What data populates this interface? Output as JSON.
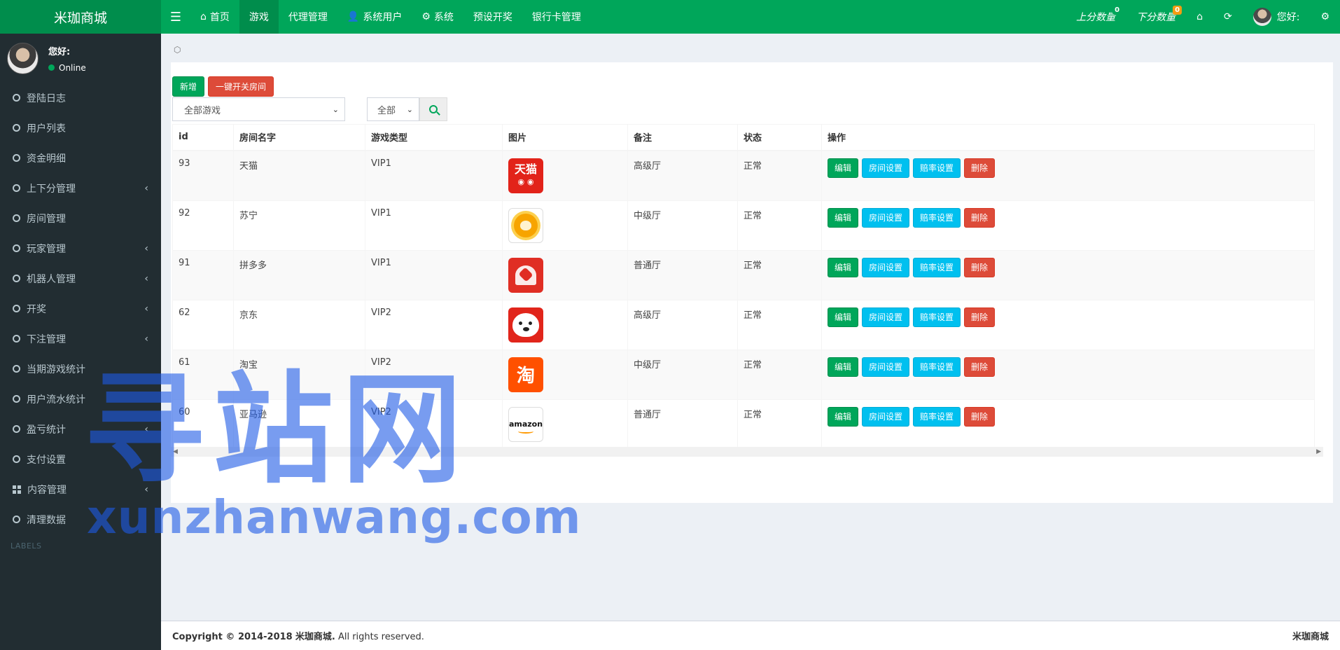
{
  "app": {
    "title": "米珈商城"
  },
  "topnav": [
    {
      "label": "首页",
      "icon": "home-icon"
    },
    {
      "label": "游戏",
      "icon": ""
    },
    {
      "label": "代理管理",
      "icon": ""
    },
    {
      "label": "系统用户",
      "icon": "user-icon"
    },
    {
      "label": "系统",
      "icon": "gear-icon"
    },
    {
      "label": "预设开奖",
      "icon": ""
    },
    {
      "label": "银行卡管理",
      "icon": ""
    }
  ],
  "topright": {
    "up_label": "上分数量",
    "up_count": "0",
    "up_badge_color": "#00a65a",
    "down_label": "下分数量",
    "down_count": "0",
    "down_badge_color": "#f39c12",
    "greeting": "您好:"
  },
  "user": {
    "name": "您好:",
    "status": "Online"
  },
  "sidebar": {
    "items": [
      {
        "label": "登陆日志",
        "has_children": false
      },
      {
        "label": "用户列表",
        "has_children": false
      },
      {
        "label": "资金明细",
        "has_children": false
      },
      {
        "label": "上下分管理",
        "has_children": true
      },
      {
        "label": "房间管理",
        "has_children": false
      },
      {
        "label": "玩家管理",
        "has_children": true
      },
      {
        "label": "机器人管理",
        "has_children": true
      },
      {
        "label": "开奖",
        "has_children": true
      },
      {
        "label": "下注管理",
        "has_children": true
      },
      {
        "label": "当期游戏统计",
        "has_children": false
      },
      {
        "label": "用户流水统计",
        "has_children": false
      },
      {
        "label": "盈亏统计",
        "has_children": true
      },
      {
        "label": "支付设置",
        "has_children": false
      },
      {
        "label": "内容管理",
        "has_children": true,
        "icon": "grid-icon"
      },
      {
        "label": "清理数据",
        "has_children": false
      }
    ],
    "header": "LABELS"
  },
  "toolbar": {
    "add_label": "新增",
    "toggle_rooms_label": "一键开关房间"
  },
  "filters": {
    "game_select": "全部游戏",
    "status_select": "全部"
  },
  "table": {
    "columns": [
      "id",
      "房间名字",
      "游戏类型",
      "图片",
      "备注",
      "状态",
      "操作"
    ],
    "rows": [
      {
        "id": "93",
        "name": "天猫",
        "type": "VIP1",
        "image": "tmall-logo",
        "note": "高级厅",
        "status": "正常"
      },
      {
        "id": "92",
        "name": "苏宁",
        "type": "VIP1",
        "image": "suning-logo",
        "note": "中级厅",
        "status": "正常"
      },
      {
        "id": "91",
        "name": "拼多多",
        "type": "VIP1",
        "image": "pinduoduo-logo",
        "note": "普通厅",
        "status": "正常"
      },
      {
        "id": "62",
        "name": "京东",
        "type": "VIP2",
        "image": "jd-logo",
        "note": "高级厅",
        "status": "正常"
      },
      {
        "id": "61",
        "name": "淘宝",
        "type": "VIP2",
        "image": "taobao-logo",
        "note": "中级厅",
        "status": "正常"
      },
      {
        "id": "60",
        "name": "亚马逊",
        "type": "VIP2",
        "image": "amazon-logo",
        "note": "普通厅",
        "status": "正常"
      }
    ],
    "actions": {
      "edit": "编辑",
      "room_settings": "房间设置",
      "odds_settings": "赔率设置",
      "delete": "删除"
    },
    "logo_text": {
      "tmall": "天猫",
      "taobao": "淘",
      "amazon": "amazon"
    }
  },
  "watermark": {
    "cn": "寻站网",
    "en": "xunzhanwang.com"
  },
  "footer": {
    "copyright_prefix": "Copyright © 2014-2018",
    "brand": "米珈商城.",
    "suffix": "All rights reserved.",
    "right": "米珈商城"
  }
}
